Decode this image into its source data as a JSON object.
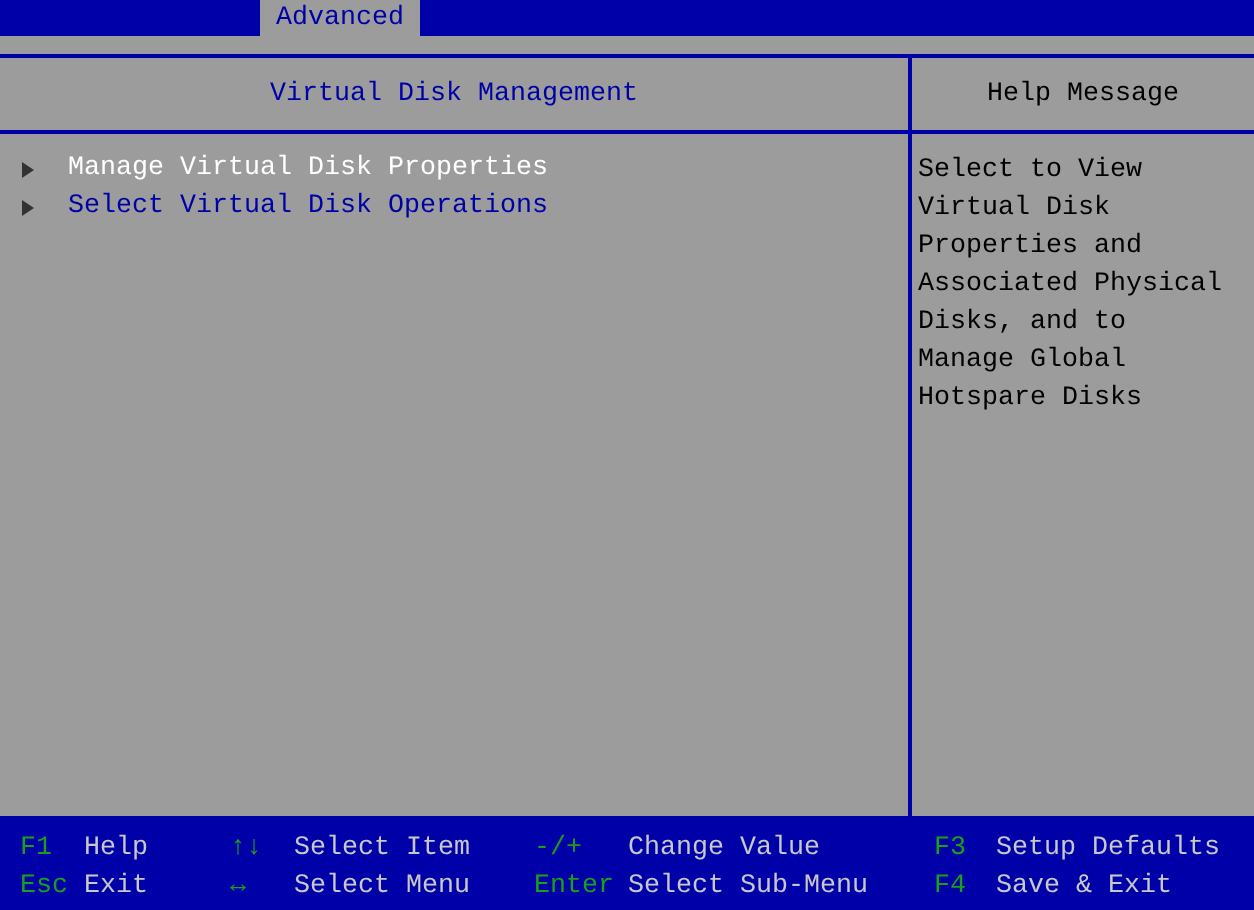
{
  "tabs": [
    {
      "label": "Advanced",
      "selected": true
    }
  ],
  "main_panel": {
    "title": "Virtual Disk Management",
    "items": [
      {
        "label": "Manage Virtual Disk Properties",
        "selected": true
      },
      {
        "label": "Select Virtual Disk Operations",
        "selected": false
      }
    ]
  },
  "help_panel": {
    "title": "Help Message",
    "lines": [
      "Select to View",
      "Virtual Disk",
      "Properties and",
      "Associated Physical",
      "Disks, and to",
      "Manage Global",
      "Hotspare Disks"
    ]
  },
  "status_bar": [
    {
      "key": "F1",
      "action": "Help"
    },
    {
      "key": "↑↓",
      "action": "Select Item"
    },
    {
      "key": "-/+",
      "action": "Change Value"
    },
    {
      "key": "F3",
      "action": "Setup Defaults"
    },
    {
      "key": "Esc",
      "action": "Exit"
    },
    {
      "key": "↔",
      "action": "Select Menu"
    },
    {
      "key": "Enter",
      "action": "Select Sub-Menu"
    },
    {
      "key": "F4",
      "action": "Save & Exit"
    }
  ]
}
